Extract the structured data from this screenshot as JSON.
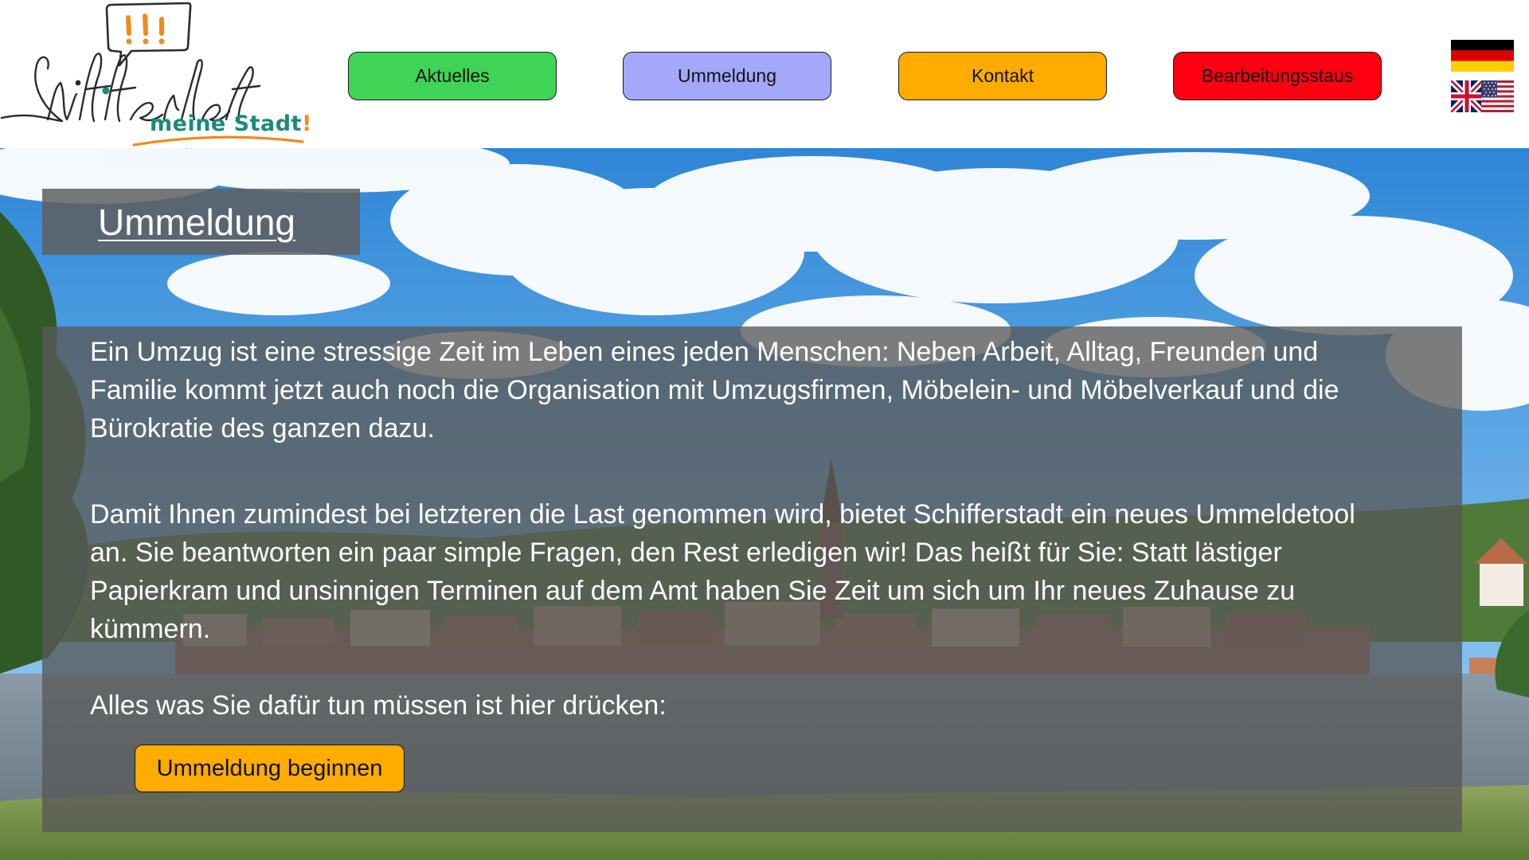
{
  "logo": {
    "script_text": "Schifferstadt",
    "tagline": "meine Stadt",
    "tagline_bang": "!",
    "bubble_text": "!!!",
    "teal": "#1a8a7c",
    "orange": "#f08a1c"
  },
  "nav": {
    "items": [
      {
        "label": "Aktuelles",
        "color": "#3fd455"
      },
      {
        "label": "Ummeldung",
        "color": "#a4a8fb"
      },
      {
        "label": "Kontakt",
        "color": "#ffab00"
      },
      {
        "label": "Bearbeitungsstaus",
        "color": "#ff0010"
      }
    ]
  },
  "languages": [
    {
      "icon": "german-flag-icon"
    },
    {
      "icon": "uk-us-flag-icon"
    }
  ],
  "page": {
    "title": "Ummeldung"
  },
  "content": {
    "paragraph1": "Ein Umzug ist eine stressige Zeit im Leben eines jeden Menschen: Neben Arbeit, Alltag, Freunden und Familie kommt jetzt auch noch die Organisation mit Umzugsfirmen, Möbelein- und Möbelverkauf und die Bürokratie des ganzen dazu.",
    "paragraph2": "Damit Ihnen zumindest bei letzteren die Last genommen wird, bietet Schifferstadt ein neues Ummeldetool an. Sie beantworten ein paar simple Fragen, den Rest erledigen wir! Das heißt für Sie: Statt lästiger Papierkram und unsinnigen Terminen auf dem Amt haben Sie Zeit um sich um Ihr neues Zuhause zu kümmern.",
    "paragraph3": "Alles was Sie dafür tun müssen ist hier drücken:",
    "start_button": "Ummeldung beginnen"
  },
  "colors": {
    "panel": "#585858",
    "button_accent": "#ffab00"
  }
}
